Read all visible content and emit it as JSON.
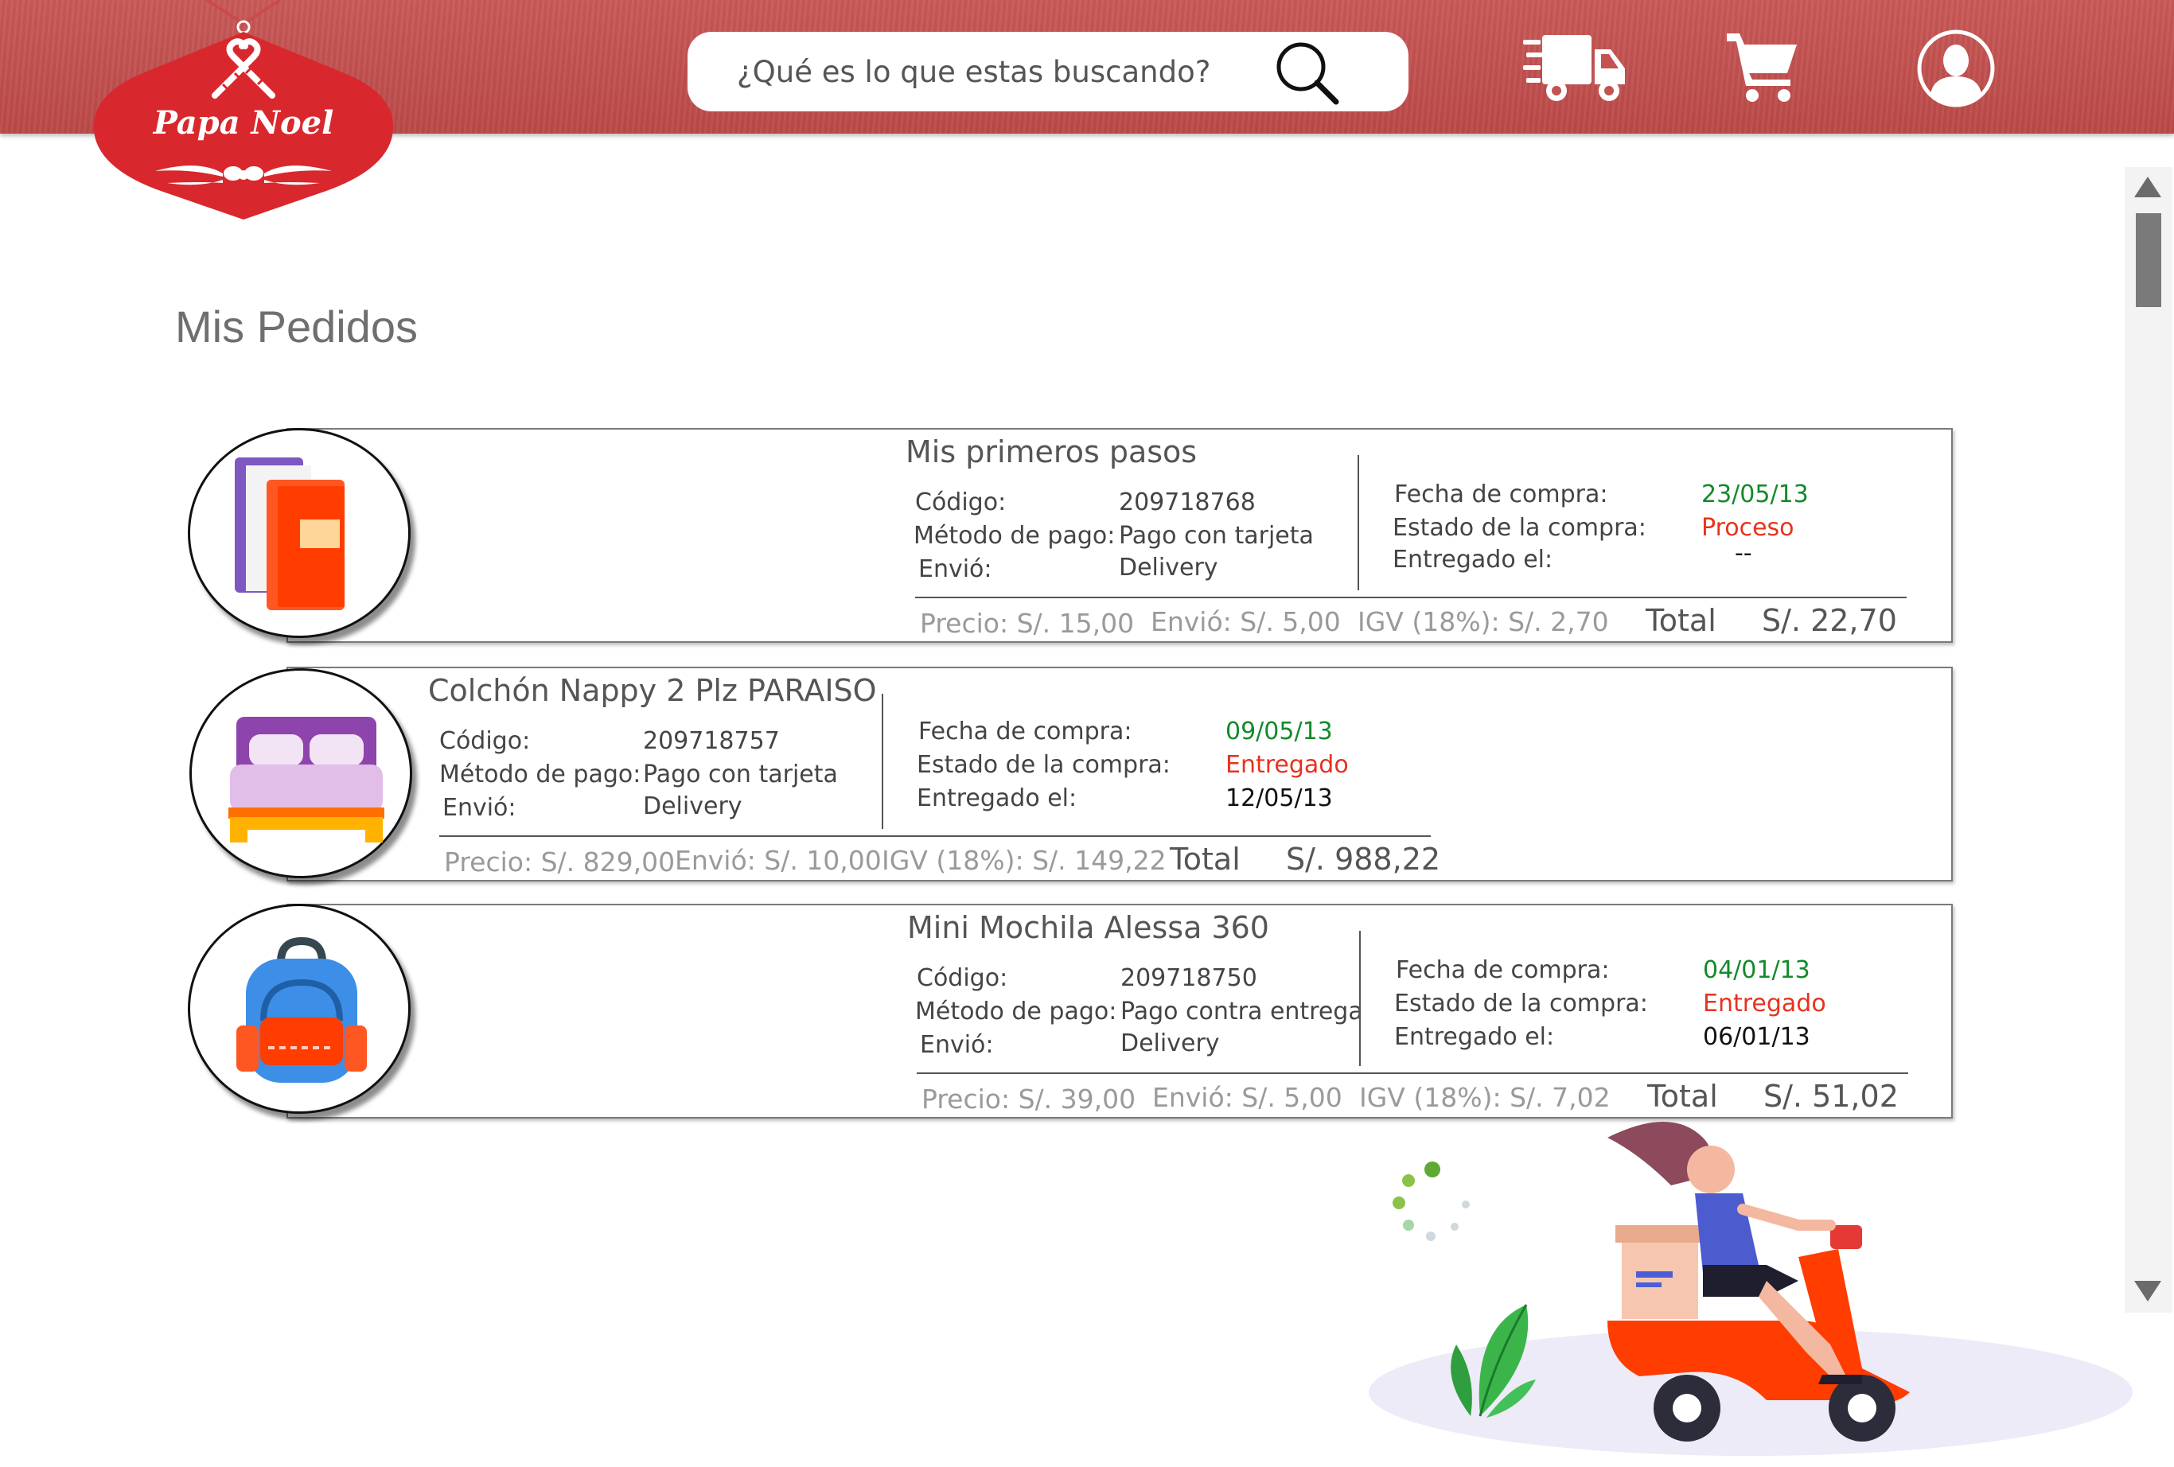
{
  "brand": {
    "name": "Papa Noel"
  },
  "search": {
    "placeholder": "¿Qué es lo que estas buscando?"
  },
  "header_icons": [
    "delivery-truck-icon",
    "shopping-cart-icon",
    "user-account-icon"
  ],
  "page": {
    "title": "Mis Pedidos"
  },
  "labels": {
    "codigo": "Código:",
    "metodo": "Método de pago:",
    "envio": "Envió:",
    "fecha": "Fecha de compra:",
    "estado": "Estado de la compra:",
    "entregado": "Entregado el:",
    "total": "Total"
  },
  "orders": [
    {
      "name": "Mis primeros pasos",
      "icon": "books-icon",
      "code": "209718768",
      "payment": "Pago con tarjeta",
      "shipping": "Delivery",
      "purchase_date": "23/05/13",
      "status": "Proceso",
      "delivered_on": "--",
      "price": "Precio: S/. 15,00",
      "shipping_cost": "Envió: S/. 5,00",
      "igv": "IGV (18%): S/. 2,70",
      "total": "S/. 22,70"
    },
    {
      "name": "Colchón Nappy 2 Plz  PARAISO",
      "icon": "bed-icon",
      "code": "209718757",
      "payment": "Pago con tarjeta",
      "shipping": "Delivery",
      "purchase_date": "09/05/13",
      "status": "Entregado",
      "delivered_on": "12/05/13",
      "price": "Precio: S/. 829,00",
      "shipping_cost": "Envió: S/. 10,00",
      "igv": "IGV (18%): S/. 149,22",
      "total": "S/. 988,22"
    },
    {
      "name": "Mini Mochila Alessa 360",
      "icon": "backpack-icon",
      "code": "209718750",
      "payment": "Pago contra entrega",
      "shipping": "Delivery",
      "purchase_date": "04/01/13",
      "status": "Entregado",
      "delivered_on": "06/01/13",
      "price": "Precio: S/. 39,00",
      "shipping_cost": "Envió: S/. 5,00",
      "igv": "IGV (18%): S/. 7,02",
      "total": "S/. 51,02"
    }
  ],
  "colors": {
    "header": "#c35351",
    "logo_red": "#d8282e",
    "status_date": "#138a2a",
    "status_state": "#e8321e"
  }
}
